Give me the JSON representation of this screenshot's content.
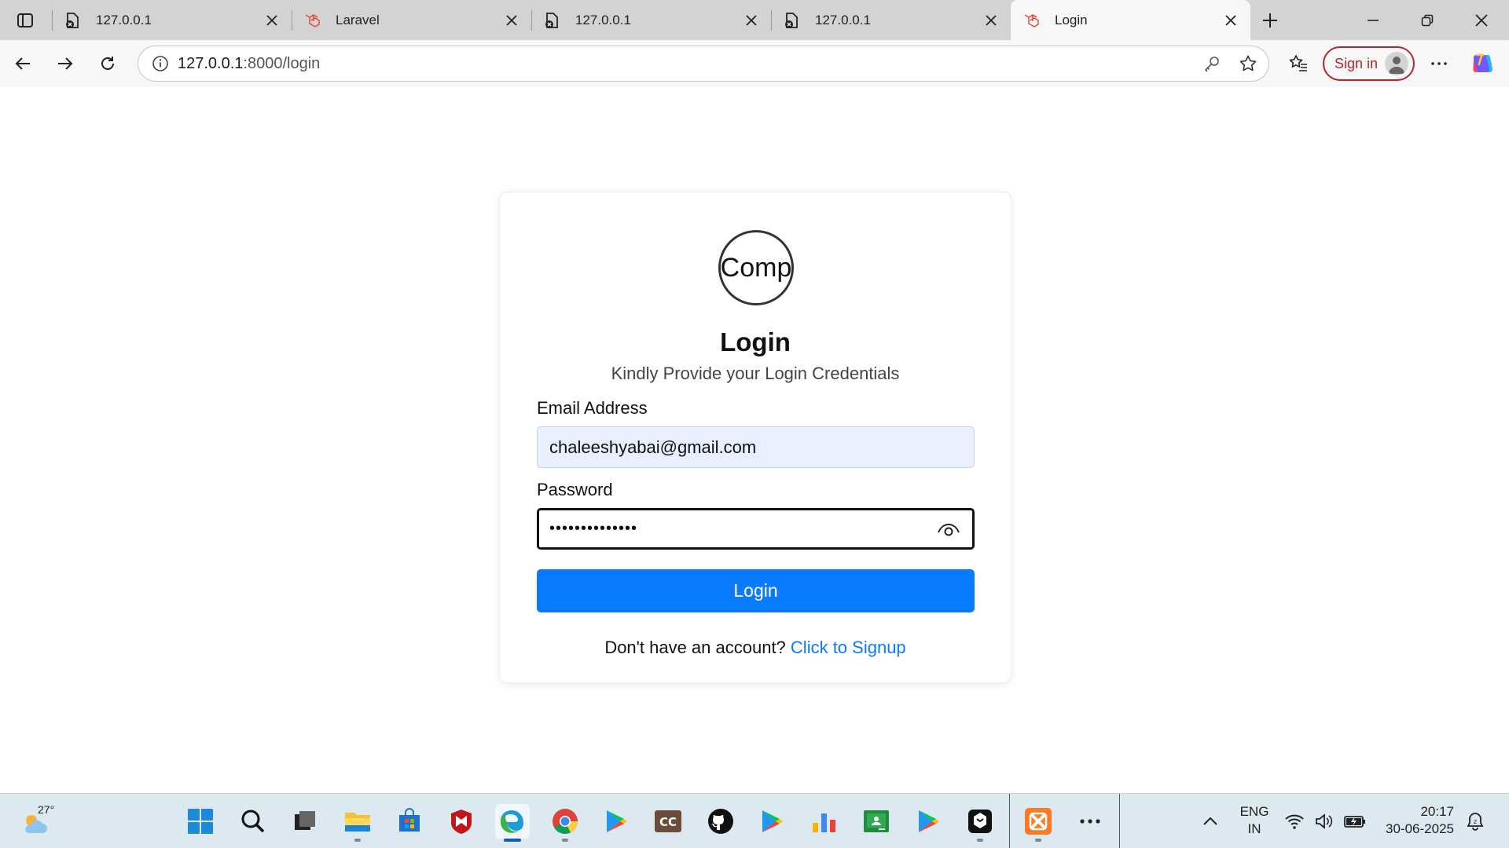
{
  "browser": {
    "tabs": [
      {
        "title": "127.0.0.1",
        "favicon": "file-error-icon",
        "active": false
      },
      {
        "title": "Laravel",
        "favicon": "laravel-icon",
        "active": false
      },
      {
        "title": "127.0.0.1",
        "favicon": "file-error-icon",
        "active": false
      },
      {
        "title": "127.0.0.1",
        "favicon": "file-error-icon",
        "active": false
      },
      {
        "title": "Login",
        "favicon": "laravel-icon",
        "active": true
      }
    ],
    "url_host": "127.0.0.1",
    "url_path": ":8000/login",
    "sign_in_label": "Sign in"
  },
  "page": {
    "logo_text": "Comp",
    "title": "Login",
    "subtitle": "Kindly Provide your Login Credentials",
    "email_label": "Email Address",
    "email_value": "chaleeshyabai@gmail.com",
    "password_label": "Password",
    "password_value": "••••••••••••••",
    "login_button": "Login",
    "signup_prompt": "Don't have an account?",
    "signup_link": "Click to Signup",
    "accent_color": "#0a7bff"
  },
  "taskbar": {
    "weather_temp": "27°",
    "language_line1": "ENG",
    "language_line2": "IN",
    "time": "20:17",
    "date": "30-06-2025",
    "apps": [
      "windows-start-icon",
      "search-icon",
      "task-view-icon",
      "file-explorer-icon",
      "microsoft-store-icon",
      "mcafee-icon",
      "edge-icon",
      "chrome-icon",
      "play-store-icon",
      "cc-icon",
      "github-icon",
      "play-store-icon",
      "charts-icon",
      "classroom-icon",
      "play-store-icon",
      "terminal-icon",
      "xampp-icon",
      "more-apps-icon"
    ]
  }
}
